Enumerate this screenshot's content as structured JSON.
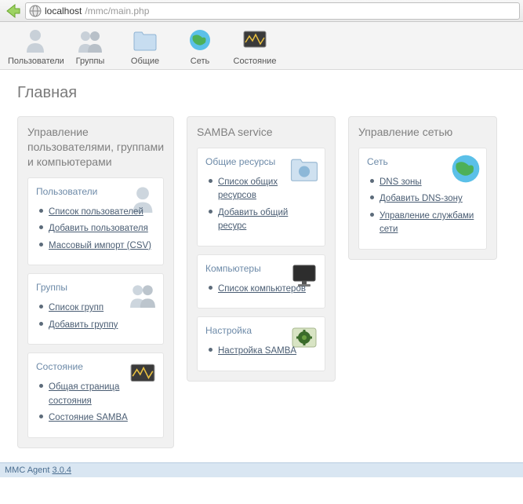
{
  "url": {
    "host": "localhost",
    "path": "/mmc/main.php"
  },
  "toolbar": {
    "items": [
      {
        "label": "Пользователи"
      },
      {
        "label": "Группы"
      },
      {
        "label": "Общие"
      },
      {
        "label": "Сеть"
      },
      {
        "label": "Состояние"
      }
    ]
  },
  "page": {
    "title": "Главная"
  },
  "columns": {
    "ugc": {
      "title": "Управление пользователями, группами и компьютерами",
      "cards": {
        "users": {
          "title": "Пользователи",
          "links": [
            "Список пользователей",
            "Добавить пользователя",
            "Массовый импорт (CSV)"
          ]
        },
        "groups": {
          "title": "Группы",
          "links": [
            "Список групп",
            "Добавить группу"
          ]
        },
        "status": {
          "title": "Состояние",
          "links": [
            "Общая страница состояния",
            "Состояние SAMBA"
          ]
        }
      }
    },
    "samba": {
      "title": "SAMBA service",
      "cards": {
        "shares": {
          "title": "Общие ресурсы",
          "links": [
            "Список общих ресурсов",
            "Добавить общий ресурс"
          ]
        },
        "computers": {
          "title": "Компьютеры",
          "links": [
            "Список компьютеров"
          ]
        },
        "config": {
          "title": "Настройка",
          "links": [
            "Настройка SAMBA"
          ]
        }
      }
    },
    "net": {
      "title": "Управление сетью",
      "cards": {
        "net": {
          "title": "Сеть",
          "links": [
            "DNS зоны",
            "Добавить DNS-зону",
            "Управление службами сети"
          ]
        }
      }
    }
  },
  "footer": {
    "text": "MMC Agent ",
    "version": "3.0.4"
  }
}
